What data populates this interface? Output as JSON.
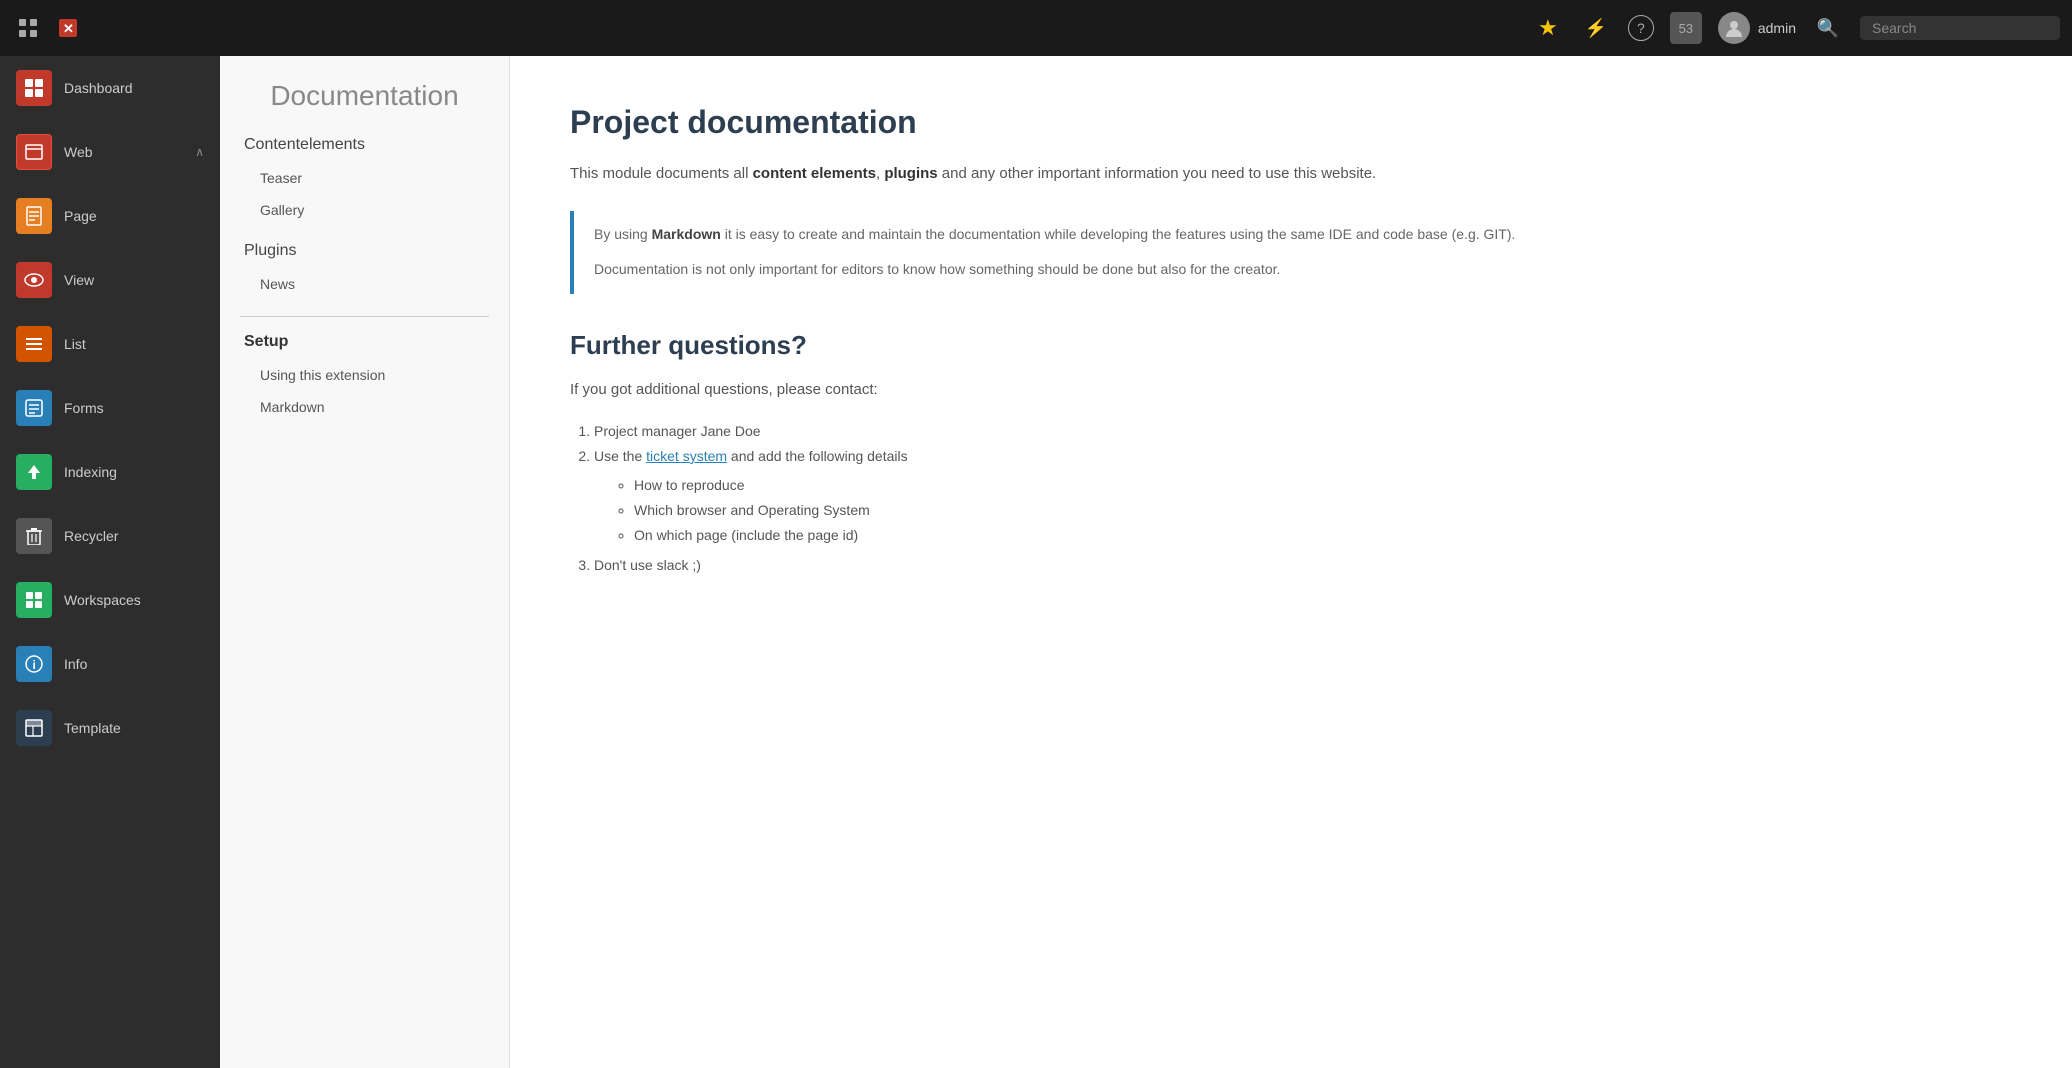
{
  "topbar": {
    "grid_icon": "⊞",
    "close_icon": "✕",
    "star_icon": "★",
    "flash_icon": "⚡",
    "help_icon": "?",
    "notification_count": "53",
    "admin_label": "admin",
    "search_placeholder": "Search"
  },
  "sidebar": {
    "items": [
      {
        "id": "dashboard",
        "label": "Dashboard",
        "icon": "dashboard",
        "icon_char": "▦",
        "has_arrow": false
      },
      {
        "id": "web",
        "label": "Web",
        "icon": "web",
        "icon_char": "⬜",
        "has_arrow": true
      },
      {
        "id": "page",
        "label": "Page",
        "icon": "page",
        "icon_char": "📄",
        "has_arrow": false
      },
      {
        "id": "view",
        "label": "View",
        "icon": "view",
        "icon_char": "👁",
        "has_arrow": false
      },
      {
        "id": "list",
        "label": "List",
        "icon": "list",
        "icon_char": "☰",
        "has_arrow": false
      },
      {
        "id": "forms",
        "label": "Forms",
        "icon": "forms",
        "icon_char": "⬜",
        "has_arrow": false
      },
      {
        "id": "indexing",
        "label": "Indexing",
        "icon": "indexing",
        "icon_char": "⬆",
        "has_arrow": false
      },
      {
        "id": "recycler",
        "label": "Recycler",
        "icon": "recycler",
        "icon_char": "🗑",
        "has_arrow": false
      },
      {
        "id": "workspaces",
        "label": "Workspaces",
        "icon": "workspaces",
        "icon_char": "⬜",
        "has_arrow": false
      },
      {
        "id": "info",
        "label": "Info",
        "icon": "info",
        "icon_char": "ℹ",
        "has_arrow": false
      },
      {
        "id": "template",
        "label": "Template",
        "icon": "template",
        "icon_char": "⬜",
        "has_arrow": false
      }
    ]
  },
  "doc_panel": {
    "title": "Documentation",
    "contentelements_label": "Contentelements",
    "items_contentelements": [
      {
        "label": "Teaser"
      },
      {
        "label": "Gallery"
      }
    ],
    "plugins_label": "Plugins",
    "items_plugins": [
      {
        "label": "News"
      }
    ],
    "setup_label": "Setup",
    "items_setup": [
      {
        "label": "Using this extension"
      },
      {
        "label": "Markdown"
      }
    ]
  },
  "content": {
    "title": "Project documentation",
    "intro": "This module documents all content elements, plugins and any other important information you need to use this website.",
    "intro_bold1": "content elements",
    "intro_bold2": "plugins",
    "blockquote1": "By using Markdown it is easy to create and maintain the documentation while developing the features using the same IDE and code base (e.g. GIT).",
    "blockquote1_bold": "Markdown",
    "blockquote2": "Documentation is not only important for editors to know how something should be done but also for the creator.",
    "further_title": "Further questions?",
    "further_intro": "If you got additional questions, please contact:",
    "list_items": [
      {
        "text": "Project manager Jane Doe",
        "has_link": false
      },
      {
        "text": "Use the ticket system and add the following details",
        "has_link": true,
        "link_text": "ticket system"
      }
    ],
    "sub_items": [
      "How to reproduce",
      "Which browser and Operating System",
      "On which page (include the page id)"
    ],
    "list_item3": "Don't use slack ;)"
  }
}
